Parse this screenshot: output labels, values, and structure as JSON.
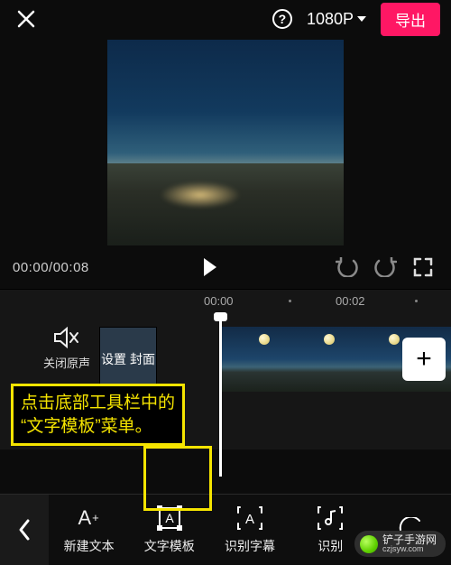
{
  "topbar": {
    "resolution": "1080P",
    "export_label": "导出"
  },
  "playbar": {
    "current_time": "00:00",
    "total_time": "00:08"
  },
  "ruler": {
    "marks": [
      "00:00",
      "00:02"
    ]
  },
  "timeline": {
    "mute_label": "关闭原声",
    "cover_label": "设置\n封面",
    "add_label": "+"
  },
  "annotation": {
    "line1": "点击底部工具栏中的",
    "line2": "“文字模板”菜单。"
  },
  "toolbar": {
    "items": [
      {
        "id": "new-text",
        "label": "新建文本"
      },
      {
        "id": "text-template",
        "label": "文字模板"
      },
      {
        "id": "recognize-subtitle",
        "label": "识别字幕"
      },
      {
        "id": "recognize-lyrics",
        "label": "识别"
      }
    ]
  },
  "watermark": {
    "site": "czjsyw.com",
    "name": "铲子手游网"
  }
}
